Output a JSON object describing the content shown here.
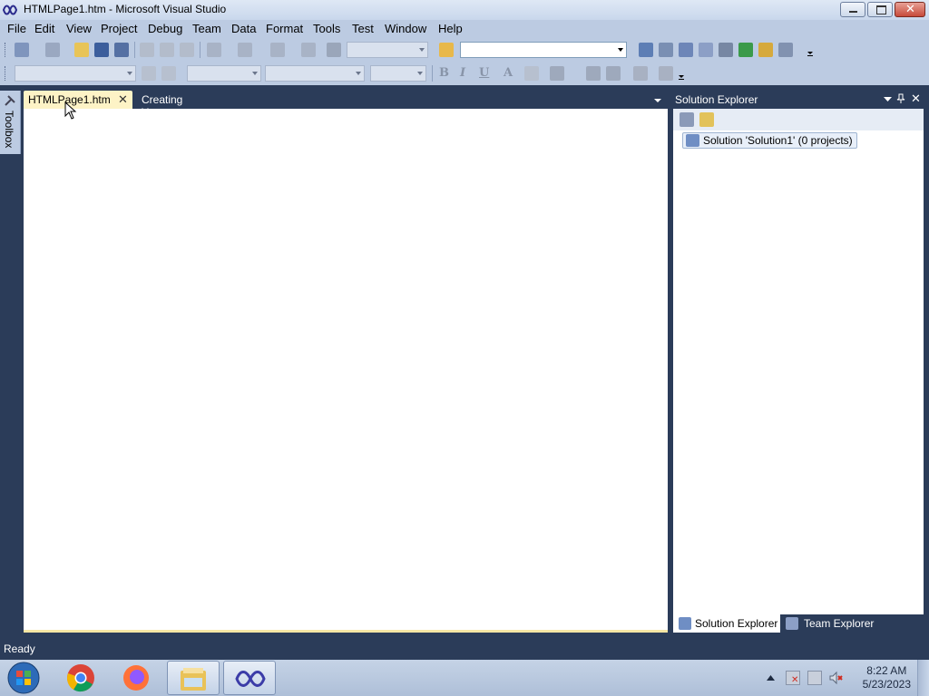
{
  "window": {
    "title": "HTMLPage1.htm - Microsoft Visual Studio"
  },
  "menu": [
    "File",
    "Edit",
    "View",
    "Project",
    "Debug",
    "Team",
    "Data",
    "Format",
    "Tools",
    "Test",
    "Window",
    "Help"
  ],
  "toolbox": {
    "label": "Toolbox"
  },
  "document_tabs": {
    "active": "HTMLPage1.htm",
    "inactive": "Creating Your First...on | Microsoft Learn"
  },
  "solution_explorer": {
    "title": "Solution Explorer",
    "root_item": "Solution 'Solution1' (0 projects)",
    "tabs": [
      "Solution Explorer",
      "Team Explorer"
    ]
  },
  "status": {
    "text": "Ready"
  },
  "taskbar": {
    "time": "8:22 AM",
    "date": "5/23/2023",
    "apps": [
      "start-orb-icon",
      "chrome-icon",
      "firefox-icon",
      "file-explorer-icon",
      "visual-studio-icon"
    ]
  },
  "colors": {
    "chrome_background": "#2b3c59",
    "toolbar": "#bccbe2",
    "active_tab": "#fdf3c6"
  }
}
